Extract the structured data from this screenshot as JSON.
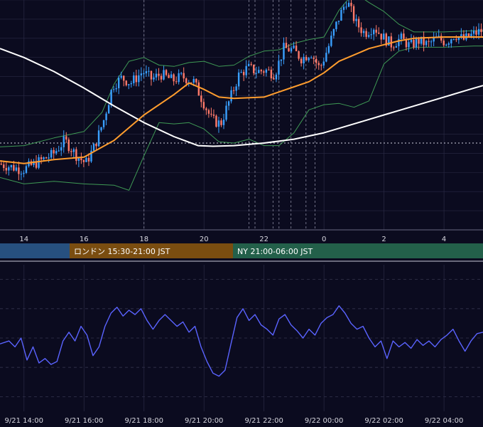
{
  "sessions": [
    {
      "label": "",
      "color": "#27507f"
    },
    {
      "label": "ロンドン 15:30-21:00 JST",
      "color": "#7a4d10"
    },
    {
      "label": "NY 21:00-06:00 JST",
      "color": "#23604a"
    }
  ],
  "colors": {
    "background": "#0b0b1f",
    "grid": "#2a2a44",
    "candle_up": "#3aa0ff",
    "candle_down": "#ff7a6a",
    "bollinger": "#3f9a55",
    "ma_short": "#ff9d2e",
    "ma_long": "#ffffff",
    "oscillator": "#5a63ff",
    "divider": "#c8c8d8"
  },
  "chart_data": [
    {
      "type": "candlestick",
      "title": "",
      "x_tick_labels": [
        "14",
        "16",
        "18",
        "20",
        "22",
        "0",
        "2",
        "4"
      ],
      "x_tick_hours": [
        14,
        16,
        18,
        20,
        22,
        24,
        26,
        28
      ],
      "x_range_hours": [
        13.2,
        29.3
      ],
      "y_range": [
        90,
        108
      ],
      "grid": true,
      "price_path": [
        [
          13.0,
          95.3
        ],
        [
          13.5,
          95.0
        ],
        [
          14.0,
          94.7
        ],
        [
          14.5,
          95.3
        ],
        [
          15.0,
          95.9
        ],
        [
          15.4,
          97.0
        ],
        [
          15.8,
          95.8
        ],
        [
          16.1,
          95.2
        ],
        [
          16.4,
          96.6
        ],
        [
          16.7,
          98.6
        ],
        [
          17.0,
          101.3
        ],
        [
          17.3,
          101.9
        ],
        [
          17.6,
          101.5
        ],
        [
          18.0,
          102.4
        ],
        [
          18.3,
          101.8
        ],
        [
          18.6,
          102.2
        ],
        [
          19.0,
          101.7
        ],
        [
          19.3,
          102.0
        ],
        [
          19.7,
          101.6
        ],
        [
          20.0,
          100.1
        ],
        [
          20.3,
          98.6
        ],
        [
          20.6,
          98.3
        ],
        [
          20.9,
          100.2
        ],
        [
          21.2,
          102.1
        ],
        [
          21.5,
          102.7
        ],
        [
          21.8,
          102.4
        ],
        [
          22.1,
          102.5
        ],
        [
          22.4,
          102.2
        ],
        [
          22.7,
          104.2
        ],
        [
          23.0,
          104.1
        ],
        [
          23.3,
          103.4
        ],
        [
          23.6,
          103.9
        ],
        [
          23.9,
          102.6
        ],
        [
          24.2,
          104.4
        ],
        [
          24.5,
          106.4
        ],
        [
          24.8,
          108.0
        ],
        [
          25.1,
          106.2
        ],
        [
          25.4,
          105.4
        ],
        [
          25.7,
          105.9
        ],
        [
          26.0,
          105.1
        ],
        [
          26.3,
          104.5
        ],
        [
          26.6,
          105.0
        ],
        [
          26.9,
          104.4
        ],
        [
          27.2,
          104.8
        ],
        [
          27.5,
          104.5
        ],
        [
          27.8,
          105.0
        ],
        [
          28.1,
          104.7
        ],
        [
          28.4,
          105.3
        ],
        [
          28.7,
          104.9
        ],
        [
          29.0,
          105.3
        ],
        [
          29.3,
          105.6
        ]
      ],
      "ma_short": [
        [
          13.2,
          95.4
        ],
        [
          14.0,
          95.2
        ],
        [
          15.0,
          95.5
        ],
        [
          16.0,
          95.7
        ],
        [
          17.0,
          97.0
        ],
        [
          18.0,
          99.0
        ],
        [
          19.0,
          100.6
        ],
        [
          19.5,
          101.5
        ],
        [
          20.0,
          101.0
        ],
        [
          20.5,
          100.4
        ],
        [
          21.0,
          100.3
        ],
        [
          22.0,
          100.4
        ],
        [
          23.0,
          101.2
        ],
        [
          23.5,
          101.6
        ],
        [
          24.0,
          102.3
        ],
        [
          24.5,
          103.2
        ],
        [
          25.0,
          103.7
        ],
        [
          25.5,
          104.2
        ],
        [
          26.0,
          104.5
        ],
        [
          26.5,
          104.8
        ],
        [
          27.0,
          105.0
        ],
        [
          28.0,
          105.1
        ],
        [
          29.0,
          105.1
        ],
        [
          29.3,
          105.1
        ]
      ],
      "ma_long": [
        [
          13.2,
          104.2
        ],
        [
          14.0,
          103.5
        ],
        [
          15.0,
          102.4
        ],
        [
          16.0,
          101.1
        ],
        [
          17.0,
          99.7
        ],
        [
          18.0,
          98.4
        ],
        [
          19.0,
          97.3
        ],
        [
          19.8,
          96.6
        ],
        [
          20.3,
          96.55
        ],
        [
          21.0,
          96.6
        ],
        [
          22.0,
          96.8
        ],
        [
          23.0,
          97.1
        ],
        [
          24.0,
          97.6
        ],
        [
          25.0,
          98.3
        ],
        [
          26.0,
          99.0
        ],
        [
          27.0,
          99.7
        ],
        [
          28.0,
          100.4
        ],
        [
          29.0,
          101.1
        ],
        [
          29.3,
          101.3
        ]
      ],
      "bollinger_upper": [
        [
          13.2,
          96.5
        ],
        [
          14.0,
          96.6
        ],
        [
          15.0,
          97.2
        ],
        [
          16.0,
          97.7
        ],
        [
          16.6,
          99.2
        ],
        [
          17.0,
          101.4
        ],
        [
          17.5,
          103.2
        ],
        [
          18.0,
          103.5
        ],
        [
          18.5,
          102.9
        ],
        [
          19.0,
          102.8
        ],
        [
          19.5,
          103.1
        ],
        [
          20.0,
          103.2
        ],
        [
          20.5,
          102.8
        ],
        [
          21.0,
          102.9
        ],
        [
          21.5,
          103.6
        ],
        [
          22.0,
          104.0
        ],
        [
          22.5,
          104.1
        ],
        [
          23.0,
          104.6
        ],
        [
          23.5,
          104.9
        ],
        [
          24.0,
          105.1
        ],
        [
          24.5,
          107.2
        ],
        [
          25.0,
          108.6
        ],
        [
          25.5,
          107.8
        ],
        [
          26.0,
          107.1
        ],
        [
          26.5,
          106.1
        ],
        [
          27.0,
          105.5
        ],
        [
          28.0,
          105.5
        ],
        [
          29.0,
          105.6
        ],
        [
          29.3,
          105.6
        ]
      ],
      "bollinger_lower": [
        [
          13.2,
          94.1
        ],
        [
          14.0,
          93.6
        ],
        [
          15.0,
          93.8
        ],
        [
          16.0,
          93.6
        ],
        [
          17.0,
          93.5
        ],
        [
          17.5,
          93.1
        ],
        [
          18.0,
          95.8
        ],
        [
          18.5,
          98.4
        ],
        [
          19.0,
          98.3
        ],
        [
          19.5,
          98.4
        ],
        [
          20.0,
          97.9
        ],
        [
          20.5,
          96.9
        ],
        [
          21.0,
          96.8
        ],
        [
          21.5,
          97.1
        ],
        [
          22.0,
          96.6
        ],
        [
          22.5,
          96.6
        ],
        [
          23.0,
          97.6
        ],
        [
          23.5,
          99.4
        ],
        [
          24.0,
          99.8
        ],
        [
          24.5,
          99.9
        ],
        [
          25.0,
          99.6
        ],
        [
          25.5,
          100.1
        ],
        [
          26.0,
          103.0
        ],
        [
          26.5,
          104.0
        ],
        [
          27.0,
          104.3
        ],
        [
          28.0,
          104.3
        ],
        [
          29.0,
          104.4
        ],
        [
          29.3,
          104.4
        ]
      ],
      "horizontal_reference_line": 96.8,
      "event_marker_hours": [
        18.0,
        21.5,
        21.7,
        22.3,
        22.5,
        22.9,
        23.4,
        23.7
      ]
    },
    {
      "type": "line",
      "title": "",
      "x_tick_labels": [
        "9/21 14:00",
        "9/21 16:00",
        "9/21 18:00",
        "9/21 20:00",
        "9/21 22:00",
        "9/22 00:00",
        "9/22 02:00",
        "9/22 04:00"
      ],
      "y_range": [
        0,
        100
      ],
      "grid": true,
      "series": [
        {
          "name": "",
          "points": [
            [
              13.2,
              46
            ],
            [
              13.5,
              48
            ],
            [
              13.7,
              44
            ],
            [
              13.9,
              50
            ],
            [
              14.1,
              35
            ],
            [
              14.3,
              44
            ],
            [
              14.5,
              33
            ],
            [
              14.7,
              36
            ],
            [
              14.9,
              32
            ],
            [
              15.1,
              34
            ],
            [
              15.3,
              48
            ],
            [
              15.5,
              54
            ],
            [
              15.7,
              48
            ],
            [
              15.9,
              58
            ],
            [
              16.1,
              52
            ],
            [
              16.3,
              38
            ],
            [
              16.5,
              44
            ],
            [
              16.7,
              58
            ],
            [
              16.9,
              67
            ],
            [
              17.1,
              71
            ],
            [
              17.3,
              65
            ],
            [
              17.5,
              69
            ],
            [
              17.7,
              66
            ],
            [
              17.9,
              70
            ],
            [
              18.1,
              62
            ],
            [
              18.3,
              56
            ],
            [
              18.5,
              62
            ],
            [
              18.7,
              66
            ],
            [
              18.9,
              62
            ],
            [
              19.1,
              58
            ],
            [
              19.3,
              61
            ],
            [
              19.5,
              54
            ],
            [
              19.7,
              58
            ],
            [
              19.9,
              44
            ],
            [
              20.1,
              34
            ],
            [
              20.3,
              26
            ],
            [
              20.5,
              24
            ],
            [
              20.7,
              28
            ],
            [
              20.9,
              46
            ],
            [
              21.1,
              64
            ],
            [
              21.3,
              70
            ],
            [
              21.5,
              62
            ],
            [
              21.7,
              66
            ],
            [
              21.9,
              59
            ],
            [
              22.1,
              56
            ],
            [
              22.3,
              52
            ],
            [
              22.5,
              63
            ],
            [
              22.7,
              66
            ],
            [
              22.9,
              59
            ],
            [
              23.1,
              55
            ],
            [
              23.3,
              50
            ],
            [
              23.5,
              56
            ],
            [
              23.7,
              52
            ],
            [
              23.9,
              60
            ],
            [
              24.1,
              64
            ],
            [
              24.3,
              66
            ],
            [
              24.5,
              72
            ],
            [
              24.7,
              67
            ],
            [
              24.9,
              60
            ],
            [
              25.1,
              56
            ],
            [
              25.3,
              58
            ],
            [
              25.5,
              50
            ],
            [
              25.7,
              44
            ],
            [
              25.9,
              48
            ],
            [
              26.1,
              36
            ],
            [
              26.3,
              48
            ],
            [
              26.5,
              44
            ],
            [
              26.7,
              47
            ],
            [
              26.9,
              43
            ],
            [
              27.1,
              49
            ],
            [
              27.3,
              45
            ],
            [
              27.5,
              48
            ],
            [
              27.7,
              44
            ],
            [
              27.9,
              49
            ],
            [
              28.1,
              52
            ],
            [
              28.3,
              56
            ],
            [
              28.5,
              48
            ],
            [
              28.7,
              41
            ],
            [
              28.9,
              48
            ],
            [
              29.1,
              53
            ],
            [
              29.3,
              54
            ]
          ]
        }
      ]
    }
  ]
}
